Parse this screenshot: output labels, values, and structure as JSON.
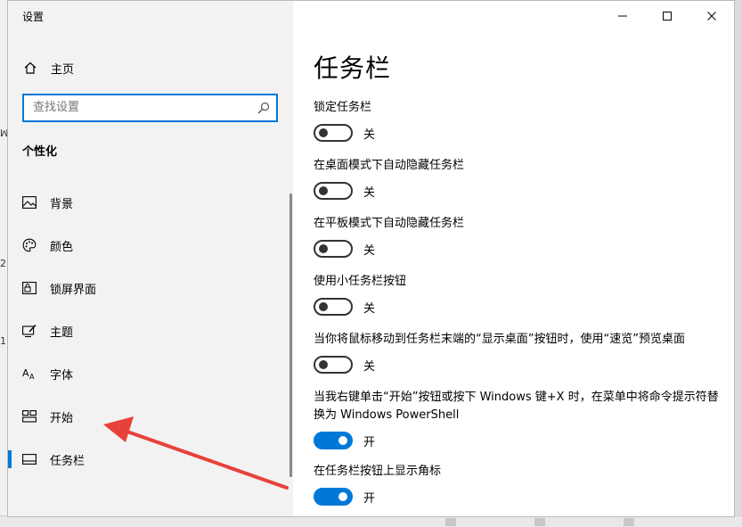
{
  "window": {
    "title": "设置",
    "controls": [
      "minimize",
      "maximize",
      "close"
    ]
  },
  "sidebar": {
    "home_label": "主页",
    "search": {
      "placeholder": "查找设置",
      "value": ""
    },
    "section_title": "个性化",
    "items": [
      {
        "label": "背景",
        "icon": "picture-icon",
        "selected": false
      },
      {
        "label": "颜色",
        "icon": "palette-icon",
        "selected": false
      },
      {
        "label": "锁屏界面",
        "icon": "lock-screen-icon",
        "selected": false
      },
      {
        "label": "主题",
        "icon": "theme-icon",
        "selected": false
      },
      {
        "label": "字体",
        "icon": "font-icon",
        "selected": false
      },
      {
        "label": "开始",
        "icon": "start-icon",
        "selected": false
      },
      {
        "label": "任务栏",
        "icon": "taskbar-icon",
        "selected": true
      }
    ]
  },
  "main": {
    "title": "任务栏",
    "settings": [
      {
        "label": "锁定任务栏",
        "state": "关",
        "on": false
      },
      {
        "label": "在桌面模式下自动隐藏任务栏",
        "state": "关",
        "on": false
      },
      {
        "label": "在平板模式下自动隐藏任务栏",
        "state": "关",
        "on": false
      },
      {
        "label": "使用小任务栏按钮",
        "state": "关",
        "on": false
      },
      {
        "label": "当你将鼠标移动到任务栏末端的“显示桌面”按钮时，使用“速览”预览桌面",
        "state": "关",
        "on": false
      },
      {
        "label": "当我右键单击“开始”按钮或按下 Windows 键+X 时，在菜单中将命令提示符替换为 Windows PowerShell",
        "state": "开",
        "on": true
      },
      {
        "label": "在任务栏按钮上显示角标",
        "state": "开",
        "on": true
      }
    ]
  },
  "background_fragments": [
    "ꟽ",
    "2",
    "1"
  ],
  "colors": {
    "accent": "#0078d7",
    "annotation_arrow": "#e8413a",
    "sidebar_bg": "#f2f2f2"
  }
}
